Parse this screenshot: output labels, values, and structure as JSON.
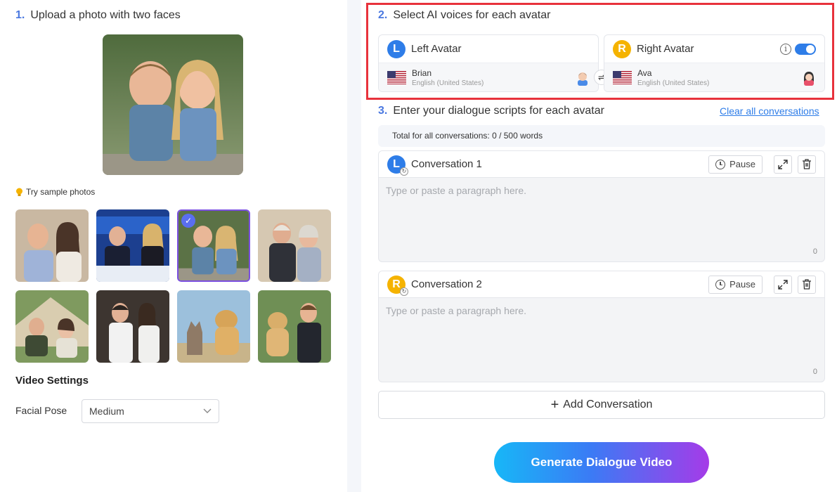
{
  "left": {
    "step1": {
      "num": "1.",
      "title": "Upload a photo with two faces"
    },
    "sample_label": "Try sample photos",
    "video_settings_title": "Video Settings",
    "facial_pose": {
      "label": "Facial Pose",
      "value": "Medium"
    }
  },
  "right": {
    "step2": {
      "num": "2.",
      "title": "Select AI voices for each avatar"
    },
    "left_avatar": {
      "badge": "L",
      "title": "Left Avatar",
      "voice": "Brian",
      "language": "English (United States)"
    },
    "right_avatar": {
      "badge": "R",
      "title": "Right Avatar",
      "voice": "Ava",
      "language": "English (United States)",
      "info": "i"
    },
    "swap_symbol": "⇌",
    "step3": {
      "num": "3.",
      "title": "Enter your dialogue scripts for each avatar"
    },
    "clear_all": "Clear all conversations",
    "total": "Total for all conversations: 0 / 500 words",
    "conversations": [
      {
        "badge": "L",
        "title": "Conversation 1",
        "pause": "Pause",
        "placeholder": "Type or paste a paragraph here.",
        "count": "0"
      },
      {
        "badge": "R",
        "title": "Conversation 2",
        "pause": "Pause",
        "placeholder": "Type or paste a paragraph here.",
        "count": "0"
      }
    ],
    "add_conversation": "Add Conversation",
    "add_symbol": "+",
    "generate": "Generate Dialogue Video"
  },
  "colors": {
    "accent": "#2e7de8",
    "highlight_box": "#e8323c",
    "right_badge": "#f5b300"
  }
}
